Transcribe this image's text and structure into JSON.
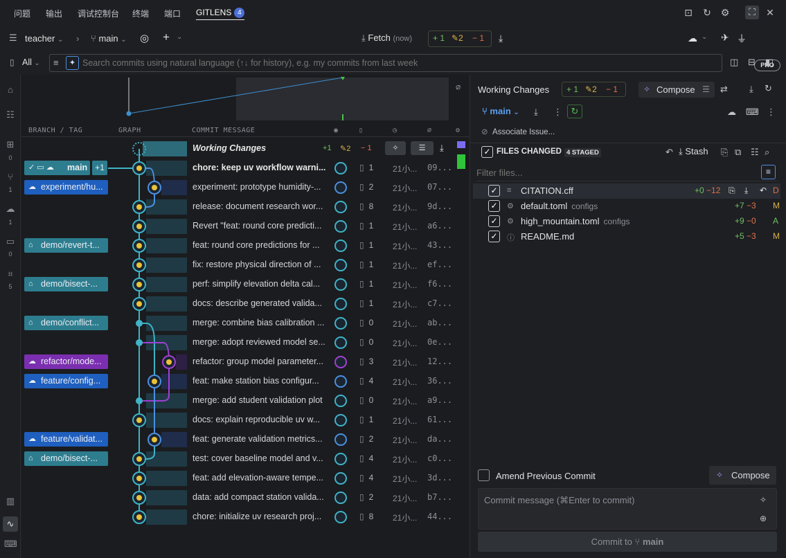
{
  "panel_tabs": [
    {
      "label": "问题"
    },
    {
      "label": "输出"
    },
    {
      "label": "调试控制台"
    },
    {
      "label": "终端"
    },
    {
      "label": "端口"
    },
    {
      "label": "GITLENS",
      "badge": "4"
    }
  ],
  "toolbar": {
    "repo": "teacher",
    "branch": "main",
    "fetch_label": "Fetch",
    "fetch_time": "(now)",
    "added": "1",
    "modified": "2",
    "deleted": "1",
    "pro_label": "PRO"
  },
  "search": {
    "scope": "All",
    "placeholder": "Search commits using natural language (↑↓ for history), e.g. my commits from last week"
  },
  "activity_counts": [
    "0",
    "1",
    "1",
    "0",
    "5"
  ],
  "columns": {
    "branch_tag": "BRANCH / TAG",
    "graph": "GRAPH",
    "commit_message": "COMMIT MESSAGE"
  },
  "working_changes_row": {
    "label": "Working Changes",
    "added": "1",
    "modified": "2",
    "deleted": "1"
  },
  "commits": [
    {
      "message": "chore: keep uv workflow warni...",
      "files": "1",
      "date": "21小...",
      "sha": "09...",
      "ref": "main",
      "ref_extra": "+1",
      "ref_color": "#2d7d8f",
      "bold": true
    },
    {
      "message": "experiment: prototype humidity-...",
      "files": "2",
      "date": "21小...",
      "sha": "07...",
      "ref": "experiment/hu...",
      "ref_color": "#1f5fbf"
    },
    {
      "message": "release: document research wor...",
      "files": "8",
      "date": "21小...",
      "sha": "9d..."
    },
    {
      "message": "Revert \"feat: round core predicti...",
      "files": "1",
      "date": "21小...",
      "sha": "a6..."
    },
    {
      "message": "feat: round core predictions for ...",
      "files": "1",
      "date": "21小...",
      "sha": "43...",
      "ref": "demo/revert-t...",
      "ref_color": "#2d7d8f"
    },
    {
      "message": "fix: restore physical direction of ...",
      "files": "1",
      "date": "21小...",
      "sha": "ef..."
    },
    {
      "message": "perf: simplify elevation delta cal...",
      "files": "1",
      "date": "21小...",
      "sha": "f6...",
      "ref": "demo/bisect-...",
      "ref_color": "#2d7d8f"
    },
    {
      "message": "docs: describe generated valida...",
      "files": "1",
      "date": "21小...",
      "sha": "c7..."
    },
    {
      "message": "merge: combine bias calibration ...",
      "files": "0",
      "date": "21小...",
      "sha": "ab...",
      "ref": "demo/conflict...",
      "ref_color": "#2d7d8f"
    },
    {
      "message": "merge: adopt reviewed model se...",
      "files": "0",
      "date": "21小...",
      "sha": "0e..."
    },
    {
      "message": "refactor: group model parameter...",
      "files": "3",
      "date": "21小...",
      "sha": "12...",
      "ref": "refactor/mode...",
      "ref_color": "#7b2fb0"
    },
    {
      "message": "feat: make station bias configur...",
      "files": "4",
      "date": "21小...",
      "sha": "36...",
      "ref": "feature/config...",
      "ref_color": "#1f5fbf"
    },
    {
      "message": "merge: add student validation plot",
      "files": "0",
      "date": "21小...",
      "sha": "a9..."
    },
    {
      "message": "docs: explain reproducible uv w...",
      "files": "1",
      "date": "21小...",
      "sha": "61..."
    },
    {
      "message": "feat: generate validation metrics...",
      "files": "2",
      "date": "21小...",
      "sha": "da...",
      "ref": "feature/validat...",
      "ref_color": "#1f5fbf"
    },
    {
      "message": "test: cover baseline model and v...",
      "files": "4",
      "date": "21小...",
      "sha": "c0...",
      "ref": "demo/bisect-...",
      "ref_color": "#2d7d8f"
    },
    {
      "message": "feat: add elevation-aware tempe...",
      "files": "4",
      "date": "21小...",
      "sha": "3d..."
    },
    {
      "message": "data: add compact station valida...",
      "files": "2",
      "date": "21小...",
      "sha": "b7..."
    },
    {
      "message": "chore: initialize uv research proj...",
      "files": "8",
      "date": "21小...",
      "sha": "44..."
    }
  ],
  "right": {
    "title": "Working Changes",
    "added": "1",
    "modified": "2",
    "deleted": "1",
    "compose_label": "Compose",
    "branch": "main",
    "associate_issue": "Associate Issue...",
    "files_changed_label": "FILES CHANGED",
    "staged_badge": "4 STAGED",
    "stash_label": "Stash",
    "filter_placeholder": "Filter files...",
    "files": [
      {
        "name": "CITATION.cff",
        "dir": "",
        "plus": "+0",
        "minus": "−12",
        "status": "D",
        "status_color": "#e0714a"
      },
      {
        "name": "default.toml",
        "dir": "configs",
        "plus": "+7",
        "minus": "−3",
        "status": "M",
        "status_color": "#d9b24a"
      },
      {
        "name": "high_mountain.toml",
        "dir": "configs",
        "plus": "+9",
        "minus": "−0",
        "status": "A",
        "status_color": "#6fc062"
      },
      {
        "name": "README.md",
        "dir": "",
        "plus": "+5",
        "minus": "−3",
        "status": "M",
        "status_color": "#d9b24a"
      }
    ],
    "amend_label": "Amend Previous Commit",
    "compose_btn": "Compose",
    "commit_placeholder": "Commit message (⌘Enter to commit)",
    "commit_to": "Commit to",
    "commit_branch": "main"
  }
}
